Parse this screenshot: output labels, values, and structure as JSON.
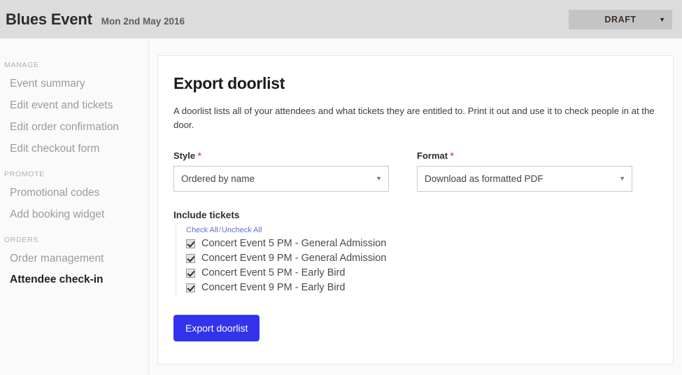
{
  "header": {
    "event_title": "Blues Event",
    "event_date": "Mon 2nd May 2016",
    "status": {
      "value": "DRAFT",
      "caret": "▼"
    }
  },
  "sidebar": {
    "groups": [
      {
        "heading": "MANAGE",
        "items": [
          {
            "label": "Event summary",
            "active": false
          },
          {
            "label": "Edit event and tickets",
            "active": false
          },
          {
            "label": "Edit order confirmation",
            "active": false
          },
          {
            "label": "Edit checkout form",
            "active": false
          }
        ]
      },
      {
        "heading": "PROMOTE",
        "items": [
          {
            "label": "Promotional codes",
            "active": false
          },
          {
            "label": "Add booking widget",
            "active": false
          }
        ]
      },
      {
        "heading": "ORDERS",
        "items": [
          {
            "label": "Order management",
            "active": false
          },
          {
            "label": "Attendee check-in",
            "active": true
          }
        ]
      }
    ]
  },
  "main": {
    "title": "Export doorlist",
    "description": "A doorlist lists all of your attendees and what tickets they are entitled to. Print it out and use it to check people in at the door.",
    "fields": {
      "style": {
        "label": "Style",
        "required_marker": "*",
        "value": "Ordered by name",
        "caret": "▼"
      },
      "format": {
        "label": "Format",
        "required_marker": "*",
        "value": "Download as formatted PDF",
        "caret": "▼"
      }
    },
    "tickets": {
      "title": "Include tickets",
      "check_all_label": "Check All",
      "separator": "/",
      "uncheck_all_label": "Uncheck All",
      "items": [
        {
          "label": "Concert Event 5 PM - General Admission",
          "checked": true
        },
        {
          "label": "Concert Event 9 PM - General Admission",
          "checked": true
        },
        {
          "label": "Concert Event 5 PM - Early Bird",
          "checked": true
        },
        {
          "label": "Concert Event 9 PM - Early Bird",
          "checked": true
        }
      ]
    },
    "submit_label": "Export doorlist"
  },
  "colors": {
    "header_bg": "#dcdcdc",
    "status_bg": "#c4c4c4",
    "primary_button": "#3333ee",
    "link": "#5b6fd6",
    "required": "#d9534f",
    "page_bg": "#fafafa"
  }
}
